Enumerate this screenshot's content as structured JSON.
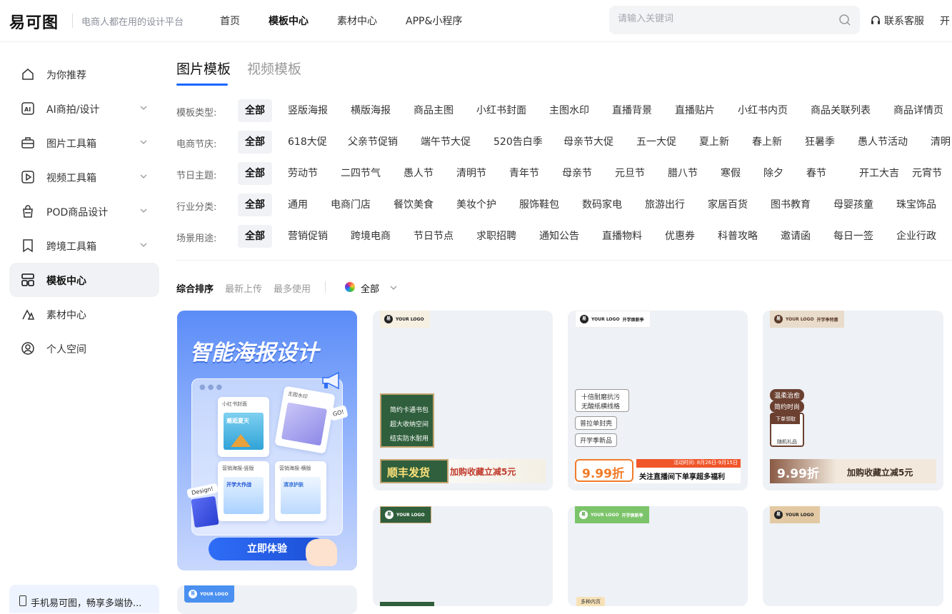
{
  "header": {
    "logo": "易可图",
    "slogan": "电商人都在用的设计平台",
    "nav": [
      "首页",
      "模板中心",
      "素材中心",
      "APP&小程序"
    ],
    "active_nav": "模板中心",
    "search_placeholder": "请输入关键词",
    "service_label": "联系客服",
    "open_label": "开"
  },
  "sidebar": {
    "items": [
      {
        "label": "为你推荐",
        "icon": "home-icon",
        "expandable": false
      },
      {
        "label": "AI商拍/设计",
        "icon": "ai-icon",
        "expandable": true
      },
      {
        "label": "图片工具箱",
        "icon": "toolbox-icon",
        "expandable": true
      },
      {
        "label": "视频工具箱",
        "icon": "video-icon",
        "expandable": true
      },
      {
        "label": "POD商品设计",
        "icon": "bag-icon",
        "expandable": true
      },
      {
        "label": "跨境工具箱",
        "icon": "bookmark-icon",
        "expandable": true
      },
      {
        "label": "模板中心",
        "icon": "template-icon",
        "expandable": false,
        "active": true
      },
      {
        "label": "素材中心",
        "icon": "shapes-icon",
        "expandable": false
      },
      {
        "label": "个人空间",
        "icon": "user-icon",
        "expandable": false
      }
    ],
    "mobile_promo": "手机易可图，畅享多端协..."
  },
  "tabs": [
    "图片模板",
    "视频模板"
  ],
  "filters": [
    {
      "label": "模板类型:",
      "options": [
        "全部",
        "竖版海报",
        "横版海报",
        "商品主图",
        "小红书封面",
        "主图水印",
        "直播背景",
        "直播贴片",
        "小红书内页",
        "商品关联列表",
        "商品详情页"
      ]
    },
    {
      "label": "电商节庆:",
      "options": [
        "全部",
        "618大促",
        "父亲节促销",
        "端午节大促",
        "520告白季",
        "母亲节大促",
        "五一大促",
        "夏上新",
        "春上新",
        "狂暑季",
        "愚人节活动",
        "清明"
      ]
    },
    {
      "label": "节日主题:",
      "options": [
        "全部",
        "劳动节",
        "二四节气",
        "愚人节",
        "清明节",
        "青年节",
        "母亲节",
        "元旦节",
        "腊八节",
        "寒假",
        "除夕",
        "春节",
        "开工大吉",
        "元宵节"
      ]
    },
    {
      "label": "行业分类:",
      "options": [
        "全部",
        "通用",
        "电商门店",
        "餐饮美食",
        "美妆个护",
        "服饰鞋包",
        "数码家电",
        "旅游出行",
        "家居百货",
        "图书教育",
        "母婴孩童",
        "珠宝饰品"
      ]
    },
    {
      "label": "场景用途:",
      "options": [
        "全部",
        "营销促销",
        "跨境电商",
        "节日节点",
        "求职招聘",
        "通知公告",
        "直播物料",
        "优惠券",
        "科普攻略",
        "邀请函",
        "每日一签",
        "企业行政"
      ]
    }
  ],
  "sort": {
    "options": [
      "综合排序",
      "最新上传",
      "最多使用"
    ],
    "color_filter": "全部"
  },
  "promo": {
    "title": "智能海报设计",
    "cards": [
      "小红书封面",
      "主图水印",
      "营销海报-竖版",
      "营销海报-横版"
    ],
    "mini_texts": [
      "邂逅夏天",
      "开学大作战",
      "清凉护肤"
    ],
    "button": "立即体验",
    "design_tag": "Design!",
    "go_tag": "GO!"
  },
  "templates": [
    {
      "logo": "YOUR LOGO",
      "tags": [
        "简约卡通书包",
        "超大收纳空间",
        "结实防水耐用"
      ],
      "price": "顺丰发货",
      "slogan": "加购收藏立减5元",
      "theme": "green"
    },
    {
      "logo": "YOUR LOGO",
      "logo_suffix": "开学焕新季",
      "tags": [
        "十倍耐磨抗污",
        "无酸纸横线格",
        "普拉单封壳",
        "开学季新品"
      ],
      "price": "9.99折",
      "slogan": "关注直播间下单享超多福利",
      "date": "活动时间: 8月26日-9月15日",
      "theme": "orange"
    },
    {
      "logo": "YOUR LOGO",
      "logo_suffix": "开学季特惠",
      "tags": [
        "温柔治愈",
        "简约时尚",
        "下单领取",
        "随机礼品"
      ],
      "price": "9.99折",
      "slogan": "加购收藏立减5元",
      "theme": "brown"
    },
    {
      "logo": "YOUR LOGO",
      "theme": "green"
    },
    {
      "logo": "YOUR LOGO",
      "logo_suffix": "开学焕新季",
      "tags": [
        "多种内页"
      ],
      "theme": "lightgreen"
    },
    {
      "logo": "YOUR LOGO",
      "theme": "tan"
    },
    {
      "logo": "YOUR LOGO",
      "theme": "blue"
    }
  ],
  "colors": {
    "accent": "#1a66ff",
    "active_bg": "#f0f2f5"
  }
}
